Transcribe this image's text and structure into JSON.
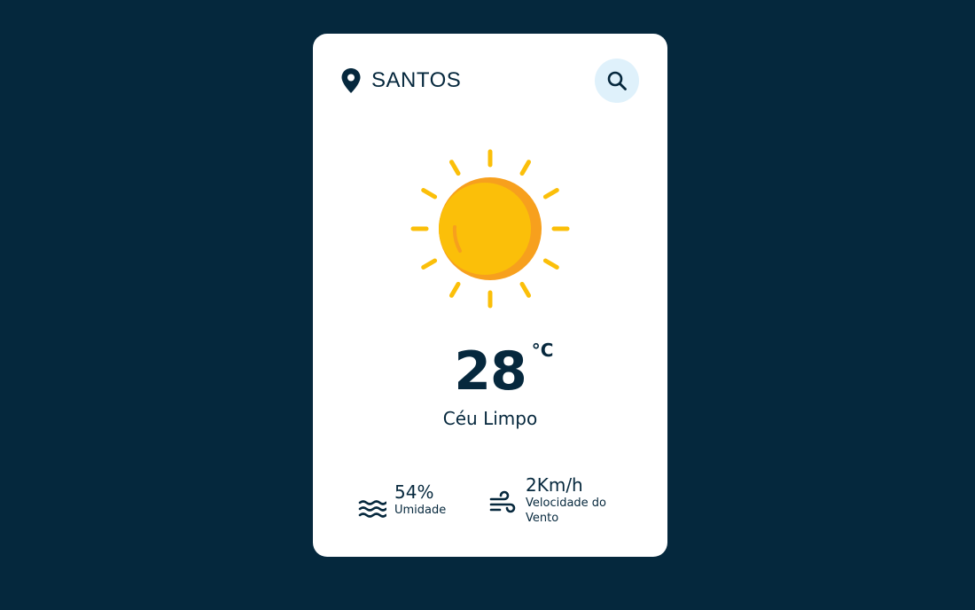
{
  "location": {
    "city": "SANTOS",
    "icon": "map-pin-icon"
  },
  "search": {
    "icon": "search-icon"
  },
  "weather": {
    "icon": "sun-icon",
    "temperature": "28",
    "unit": "°C",
    "description": "Céu Limpo"
  },
  "details": {
    "humidity": {
      "icon": "waves-icon",
      "value": "54%",
      "label": "Umidade"
    },
    "wind": {
      "icon": "wind-icon",
      "value": "2Km/h",
      "label": "Velocidade do Vento"
    }
  },
  "colors": {
    "background": "#05283d",
    "card": "#ffffff",
    "text": "#06283d",
    "search_button": "#dff1fb",
    "sun_main": "#fbbf09",
    "sun_shade": "#f7a01d"
  }
}
